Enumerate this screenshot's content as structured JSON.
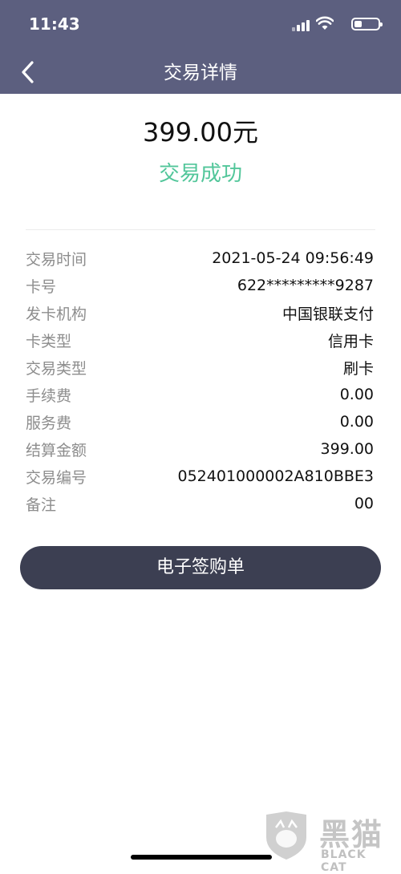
{
  "status_bar": {
    "time": "11:43",
    "icons": [
      "signal-icon",
      "wifi-icon",
      "battery-icon"
    ]
  },
  "nav": {
    "title": "交易详情",
    "back_icon": "chevron-left-icon"
  },
  "summary": {
    "amount": "399.00元",
    "status": "交易成功",
    "status_color": "#52c69a"
  },
  "details": [
    {
      "label": "交易时间",
      "value": "2021-05-24 09:56:49"
    },
    {
      "label": "卡号",
      "value": "622*********9287"
    },
    {
      "label": "发卡机构",
      "value": "中国银联支付"
    },
    {
      "label": "卡类型",
      "value": "信用卡"
    },
    {
      "label": "交易类型",
      "value": "刷卡"
    },
    {
      "label": "手续费",
      "value": "0.00"
    },
    {
      "label": "服务费",
      "value": "0.00"
    },
    {
      "label": "结算金额",
      "value": "399.00"
    },
    {
      "label": "交易编号",
      "value": "052401000002A810BBE3"
    },
    {
      "label": "备注",
      "value": "00"
    }
  ],
  "actions": {
    "receipt_label": "电子签购单"
  },
  "watermark": {
    "brand": "黑猫",
    "sub": "BLACK CAT"
  },
  "colors": {
    "header_bg": "#5c5f7f",
    "button_bg": "#3c3f52"
  }
}
